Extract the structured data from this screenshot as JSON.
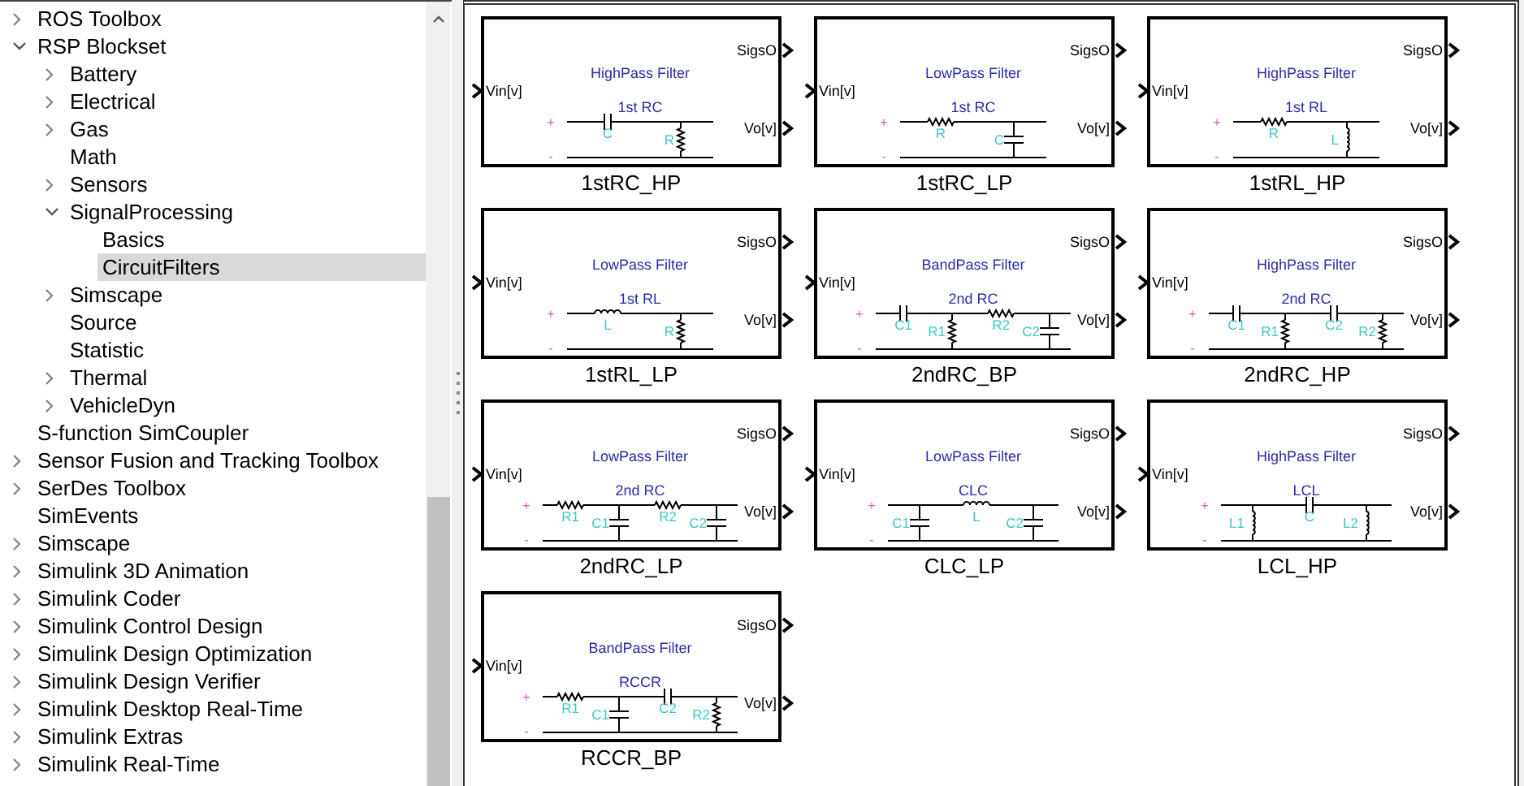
{
  "library_tree": [
    {
      "label": "ROS Toolbox",
      "expanded": false,
      "selected": false
    },
    {
      "label": "RSP Blockset",
      "expanded": true,
      "selected": false,
      "children": [
        {
          "label": "Battery",
          "expanded": false,
          "selected": false
        },
        {
          "label": "Electrical",
          "expanded": false,
          "selected": false
        },
        {
          "label": "Gas",
          "expanded": false,
          "selected": false
        },
        {
          "label": "Math",
          "selected": false
        },
        {
          "label": "Sensors",
          "expanded": false,
          "selected": false
        },
        {
          "label": "SignalProcessing",
          "expanded": true,
          "selected": false,
          "children": [
            {
              "label": "Basics",
              "selected": false
            },
            {
              "label": "CircuitFilters",
              "selected": true
            }
          ]
        },
        {
          "label": "Simscape",
          "expanded": false,
          "selected": false
        },
        {
          "label": "Source",
          "selected": false
        },
        {
          "label": "Statistic",
          "selected": false
        },
        {
          "label": "Thermal",
          "expanded": false,
          "selected": false
        },
        {
          "label": "VehicleDyn",
          "expanded": false,
          "selected": false
        }
      ]
    },
    {
      "label": "S-function SimCoupler",
      "selected": false
    },
    {
      "label": "Sensor Fusion and Tracking Toolbox",
      "expanded": false,
      "selected": false
    },
    {
      "label": "SerDes Toolbox",
      "expanded": false,
      "selected": false
    },
    {
      "label": "SimEvents",
      "selected": false
    },
    {
      "label": "Simscape",
      "expanded": false,
      "selected": false
    },
    {
      "label": "Simulink 3D Animation",
      "expanded": false,
      "selected": false
    },
    {
      "label": "Simulink Coder",
      "expanded": false,
      "selected": false
    },
    {
      "label": "Simulink Control Design",
      "expanded": false,
      "selected": false
    },
    {
      "label": "Simulink Design Optimization",
      "expanded": false,
      "selected": false
    },
    {
      "label": "Simulink Design Verifier",
      "expanded": false,
      "selected": false
    },
    {
      "label": "Simulink Desktop Real-Time",
      "expanded": false,
      "selected": false
    },
    {
      "label": "Simulink Extras",
      "expanded": false,
      "selected": false
    },
    {
      "label": "Simulink Real-Time",
      "expanded": false,
      "selected": false
    }
  ],
  "blocks": [
    {
      "name": "1stRC_HP",
      "title": "HighPass Filter",
      "topology": "1st RC",
      "input": "Vin[v]",
      "outputs": [
        "SigsO",
        "Vo[v]"
      ],
      "signs": [
        "+",
        "-"
      ],
      "components": [
        {
          "label": "C",
          "kind": "series-capacitor"
        },
        {
          "label": "R",
          "kind": "shunt-resistor"
        }
      ]
    },
    {
      "name": "1stRC_LP",
      "title": "LowPass Filter",
      "topology": "1st RC",
      "input": "Vin[v]",
      "outputs": [
        "SigsO",
        "Vo[v]"
      ],
      "signs": [
        "+",
        "-"
      ],
      "components": [
        {
          "label": "R",
          "kind": "series-resistor"
        },
        {
          "label": "C",
          "kind": "shunt-capacitor"
        }
      ]
    },
    {
      "name": "1stRL_HP",
      "title": "HighPass Filter",
      "topology": "1st RL",
      "input": "Vin[v]",
      "outputs": [
        "SigsO",
        "Vo[v]"
      ],
      "signs": [
        "+",
        "-"
      ],
      "components": [
        {
          "label": "R",
          "kind": "series-resistor"
        },
        {
          "label": "L",
          "kind": "shunt-inductor"
        }
      ]
    },
    {
      "name": "1stRL_LP",
      "title": "LowPass Filter",
      "topology": "1st RL",
      "input": "Vin[v]",
      "outputs": [
        "SigsO",
        "Vo[v]"
      ],
      "signs": [
        "+",
        "-"
      ],
      "components": [
        {
          "label": "L",
          "kind": "series-inductor"
        },
        {
          "label": "R",
          "kind": "shunt-resistor"
        }
      ]
    },
    {
      "name": "2ndRC_BP",
      "title": "BandPass Filter",
      "topology": "2nd RC",
      "input": "Vin[v]",
      "outputs": [
        "SigsO",
        "Vo[v]"
      ],
      "signs": [
        "+",
        "-"
      ],
      "components": [
        {
          "label": "C1",
          "kind": "series-capacitor"
        },
        {
          "label": "R1",
          "kind": "shunt-resistor"
        },
        {
          "label": "R2",
          "kind": "series-resistor"
        },
        {
          "label": "C2",
          "kind": "shunt-capacitor"
        }
      ]
    },
    {
      "name": "2ndRC_HP",
      "title": "HighPass Filter",
      "topology": "2nd RC",
      "input": "Vin[v]",
      "outputs": [
        "SigsO",
        "Vo[v]"
      ],
      "signs": [
        "+",
        "-"
      ],
      "components": [
        {
          "label": "C1",
          "kind": "series-capacitor"
        },
        {
          "label": "R1",
          "kind": "shunt-resistor"
        },
        {
          "label": "C2",
          "kind": "series-capacitor"
        },
        {
          "label": "R2",
          "kind": "shunt-resistor"
        }
      ]
    },
    {
      "name": "2ndRC_LP",
      "title": "LowPass Filter",
      "topology": "2nd RC",
      "input": "Vin[v]",
      "outputs": [
        "SigsO",
        "Vo[v]"
      ],
      "signs": [
        "+",
        "-"
      ],
      "components": [
        {
          "label": "R1",
          "kind": "series-resistor"
        },
        {
          "label": "C1",
          "kind": "shunt-capacitor"
        },
        {
          "label": "R2",
          "kind": "series-resistor"
        },
        {
          "label": "C2",
          "kind": "shunt-capacitor"
        }
      ]
    },
    {
      "name": "CLC_LP",
      "title": "LowPass Filter",
      "topology": "CLC",
      "input": "Vin[v]",
      "outputs": [
        "SigsO",
        "Vo[v]"
      ],
      "signs": [
        "+",
        "-"
      ],
      "components": [
        {
          "label": "C1",
          "kind": "shunt-capacitor"
        },
        {
          "label": "L",
          "kind": "series-inductor"
        },
        {
          "label": "C2",
          "kind": "shunt-capacitor"
        }
      ]
    },
    {
      "name": "LCL_HP",
      "title": "HighPass Filter",
      "topology": "LCL",
      "input": "Vin[v]",
      "outputs": [
        "SigsO",
        "Vo[v]"
      ],
      "signs": [
        "+",
        "-"
      ],
      "components": [
        {
          "label": "L1",
          "kind": "shunt-inductor"
        },
        {
          "label": "C",
          "kind": "series-capacitor"
        },
        {
          "label": "L2",
          "kind": "shunt-inductor"
        }
      ]
    },
    {
      "name": "RCCR_BP",
      "title": "BandPass Filter",
      "topology": "RCCR",
      "input": "Vin[v]",
      "outputs": [
        "SigsO",
        "Vo[v]"
      ],
      "signs": [
        "+",
        "-"
      ],
      "components": [
        {
          "label": "R1",
          "kind": "series-resistor"
        },
        {
          "label": "C1",
          "kind": "shunt-capacitor"
        },
        {
          "label": "C2",
          "kind": "series-capacitor"
        },
        {
          "label": "R2",
          "kind": "shunt-resistor"
        }
      ]
    }
  ]
}
